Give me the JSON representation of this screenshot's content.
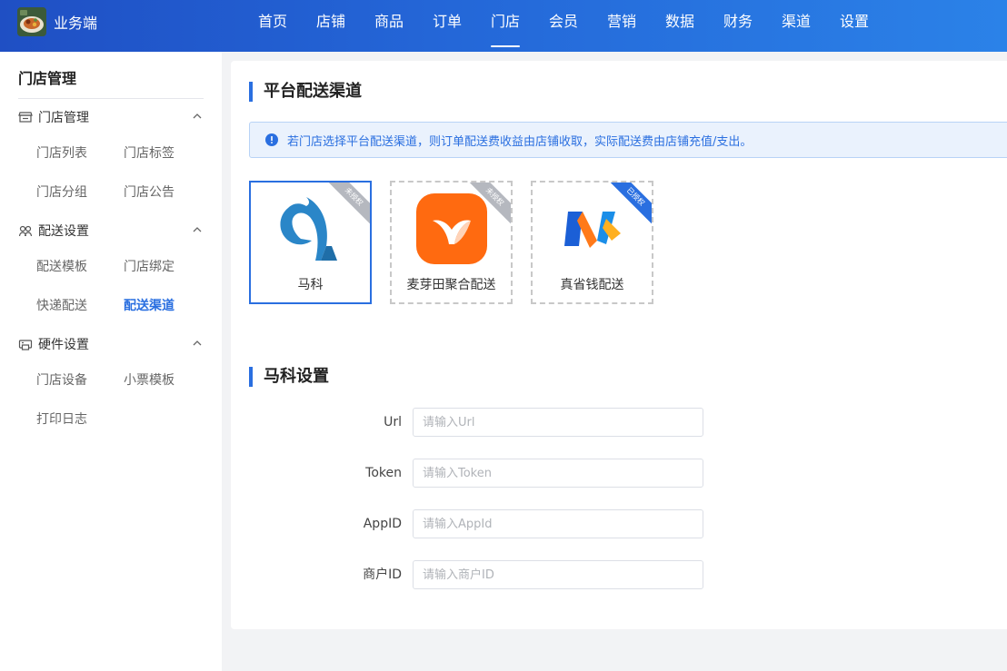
{
  "header": {
    "brand": "业务端",
    "nav": [
      {
        "label": "首页"
      },
      {
        "label": "店铺"
      },
      {
        "label": "商品"
      },
      {
        "label": "订单"
      },
      {
        "label": "门店",
        "active": true
      },
      {
        "label": "会员"
      },
      {
        "label": "营销"
      },
      {
        "label": "数据"
      },
      {
        "label": "财务"
      },
      {
        "label": "渠道"
      },
      {
        "label": "设置"
      }
    ]
  },
  "sidebar": {
    "title": "门店管理",
    "groups": [
      {
        "label": "门店管理",
        "icon": "store-icon",
        "items": [
          "门店列表",
          "门店标签",
          "门店分组",
          "门店公告"
        ]
      },
      {
        "label": "配送设置",
        "icon": "delivery-icon",
        "items": [
          "配送模板",
          "门店绑定",
          "快递配送",
          "配送渠道"
        ],
        "active_item": "配送渠道"
      },
      {
        "label": "硬件设置",
        "icon": "printer-icon",
        "items": [
          "门店设备",
          "小票模板",
          "打印日志"
        ]
      }
    ]
  },
  "main": {
    "section1_title": "平台配送渠道",
    "notice": "若门店选择平台配送渠道，则订单配送费收益由店铺收取，实际配送费由店铺充值/支出。",
    "channels": [
      {
        "name": "马科",
        "status": "未授权",
        "selected": true
      },
      {
        "name": "麦芽田聚合配送",
        "status": "未授权",
        "selected": false
      },
      {
        "name": "真省钱配送",
        "status": "已授权",
        "selected": false
      }
    ],
    "section2_title": "马科设置",
    "form": [
      {
        "label": "Url",
        "placeholder": "请输入Url",
        "value": ""
      },
      {
        "label": "Token",
        "placeholder": "请输入Token",
        "value": ""
      },
      {
        "label": "AppID",
        "placeholder": "请输入AppId",
        "value": ""
      },
      {
        "label": "商户ID",
        "placeholder": "请输入商户ID",
        "value": ""
      }
    ]
  },
  "colors": {
    "primary": "#2a6fe0",
    "header_start": "#1f4fc4",
    "header_end": "#2b82e8",
    "notice_bg": "#eaf2fd"
  }
}
